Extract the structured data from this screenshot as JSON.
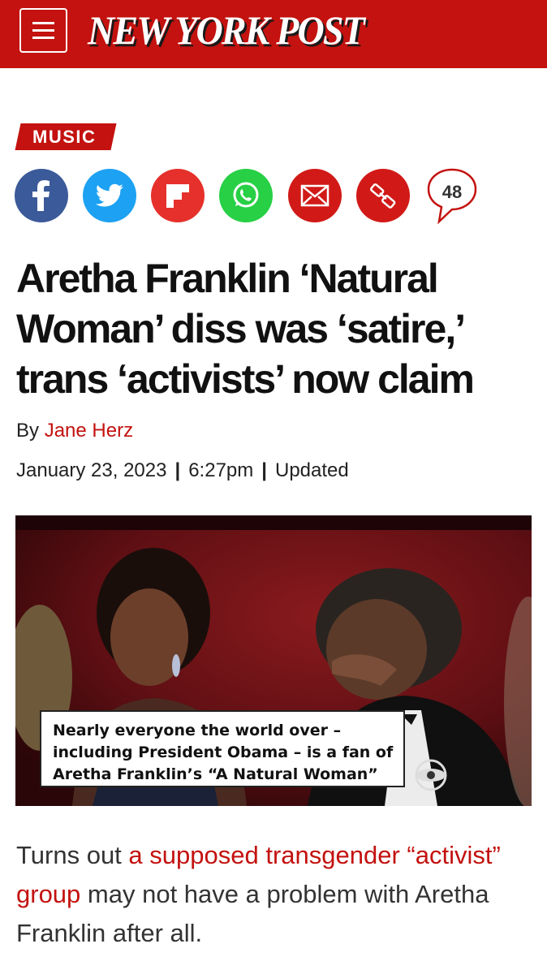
{
  "header": {
    "logo_text": "NEW YORK POST",
    "menu_icon": "hamburger-menu-icon",
    "brand_color": "#c3120f"
  },
  "article": {
    "section": "MUSIC",
    "share": {
      "icons": [
        "facebook-icon",
        "twitter-icon",
        "flipboard-icon",
        "whatsapp-icon",
        "email-icon",
        "link-icon",
        "comment-bubble-icon"
      ],
      "comment_count": "48"
    },
    "headline": {
      "line1": "Aretha Franklin ‘Natural",
      "line2": "Woman’ diss was ‘satire,’",
      "line3": "trans ‘activists’ now claim"
    },
    "byline": {
      "prefix": "By",
      "author": "Jane Herz"
    },
    "date": "January 23, 2023",
    "time": "6:27pm",
    "updated_label": "Updated",
    "image_caption": {
      "line1": "Nearly everyone the world over –",
      "line2": "including President Obama – is a fan of",
      "line3": "Aretha Franklin’s “A Natural Woman”"
    },
    "image_watermark": "cbs-eye-logo",
    "lede": {
      "before": "Turns out ",
      "link": "a supposed transgender “activist” group",
      "after": " may not have a problem with Aretha Franklin after all."
    }
  }
}
